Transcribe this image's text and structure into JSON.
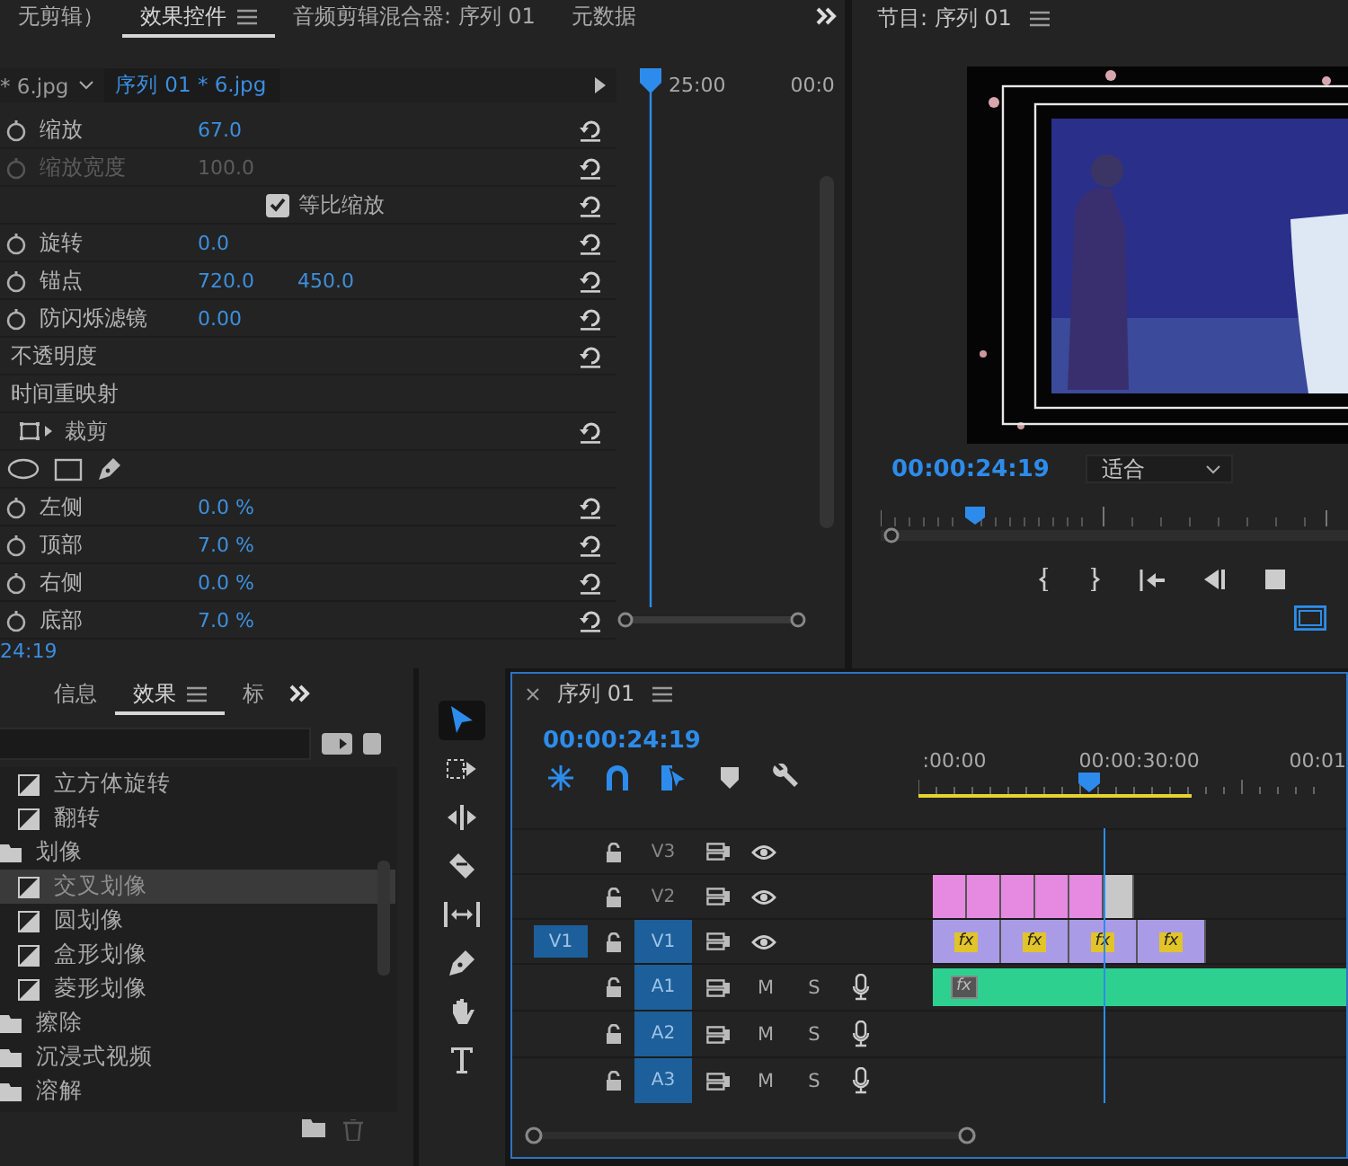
{
  "effect_controls": {
    "tabs": [
      {
        "label": "无剪辑）",
        "selected": false
      },
      {
        "label": "效果控件",
        "selected": true
      },
      {
        "label": "音频剪辑混合器: 序列 01",
        "selected": false
      },
      {
        "label": "元数据",
        "selected": false
      }
    ],
    "clip_source": "* 6.jpg",
    "clip_sequence": "序列 01 * 6.jpg",
    "ruler_labels": [
      "25:00",
      "00:0"
    ],
    "properties": [
      {
        "kind": "param",
        "name": "缩放",
        "values": [
          "67.0"
        ],
        "disabled": false,
        "reset": true
      },
      {
        "kind": "param",
        "name": "缩放宽度",
        "values": [
          "100.0"
        ],
        "disabled": true,
        "reset": true
      },
      {
        "kind": "checkbox",
        "name": "等比缩放",
        "checked": true,
        "reset": true
      },
      {
        "kind": "param",
        "name": "旋转",
        "values": [
          "0.0"
        ],
        "disabled": false,
        "reset": true
      },
      {
        "kind": "param",
        "name": "锚点",
        "values": [
          "720.0",
          "450.0"
        ],
        "disabled": false,
        "reset": true
      },
      {
        "kind": "param",
        "name": "防闪烁滤镜",
        "values": [
          "0.00"
        ],
        "disabled": false,
        "reset": true
      },
      {
        "kind": "section",
        "name": "不透明度",
        "reset": true
      },
      {
        "kind": "section",
        "name": "时间重映射",
        "reset": false
      },
      {
        "kind": "effect",
        "name": "裁剪",
        "reset": true
      },
      {
        "kind": "masks"
      },
      {
        "kind": "param",
        "name": "左侧",
        "values": [
          "0.0 %"
        ],
        "disabled": false,
        "reset": true
      },
      {
        "kind": "param",
        "name": "顶部",
        "values": [
          "7.0 %"
        ],
        "disabled": false,
        "reset": true
      },
      {
        "kind": "param",
        "name": "右侧",
        "values": [
          "0.0 %"
        ],
        "disabled": false,
        "reset": true
      },
      {
        "kind": "param",
        "name": "底部",
        "values": [
          "7.0 %"
        ],
        "disabled": false,
        "reset": true
      }
    ],
    "timecode": "24:19"
  },
  "program_monitor": {
    "title": "节目: 序列 01",
    "timecode": "00:00:24:19",
    "zoom": "适合"
  },
  "effects_panel": {
    "tabs": [
      {
        "label": "信息",
        "selected": false
      },
      {
        "label": "效果",
        "selected": true
      },
      {
        "label": "标",
        "selected": false
      }
    ],
    "items": [
      {
        "kind": "effect",
        "label": "立方体旋转",
        "selected": false
      },
      {
        "kind": "effect",
        "label": "翻转",
        "selected": false
      },
      {
        "kind": "folder",
        "label": "划像",
        "selected": false,
        "children": [
          {
            "kind": "effect",
            "label": "交叉划像",
            "selected": true
          },
          {
            "kind": "effect",
            "label": "圆划像",
            "selected": false
          },
          {
            "kind": "effect",
            "label": "盒形划像",
            "selected": false
          },
          {
            "kind": "effect",
            "label": "菱形划像",
            "selected": false
          }
        ]
      },
      {
        "kind": "folder",
        "label": "擦除",
        "selected": false
      },
      {
        "kind": "folder",
        "label": "沉浸式视频",
        "selected": false
      },
      {
        "kind": "folder",
        "label": "溶解",
        "selected": false
      }
    ]
  },
  "tools": [
    {
      "kind": "selection",
      "selected": true
    },
    {
      "kind": "track",
      "selected": false
    },
    {
      "kind": "ripple",
      "selected": false
    },
    {
      "kind": "razor",
      "selected": false
    },
    {
      "kind": "slip",
      "selected": false
    },
    {
      "kind": "pen",
      "selected": false
    },
    {
      "kind": "hand",
      "selected": false
    },
    {
      "kind": "type",
      "selected": false
    }
  ],
  "timeline": {
    "title": "序列 01",
    "timecode": "00:00:24:19",
    "toolbar": [
      {
        "kind": "nest",
        "on": true
      },
      {
        "kind": "snap",
        "on": true
      },
      {
        "kind": "linked",
        "on": true
      },
      {
        "kind": "marker",
        "on": false
      },
      {
        "kind": "settings",
        "on": false
      }
    ],
    "ruler_labels": [
      ":00:00",
      "00:00:30:00",
      "00:01"
    ],
    "tracks": [
      {
        "kind": "video",
        "name": "V3",
        "targeted": false
      },
      {
        "kind": "video",
        "name": "V2",
        "targeted": false,
        "clips": [
          {
            "color": "#e58ae0"
          },
          {
            "color": "#e58ae0"
          },
          {
            "color": "#e58ae0"
          },
          {
            "color": "#e58ae0"
          },
          {
            "color": "#e58ae0"
          },
          {
            "color": "#c8c8c8"
          }
        ]
      },
      {
        "kind": "video",
        "name": "V1",
        "source": "V1",
        "targeted": true,
        "clips": [
          {
            "color": "#a99be6",
            "fx_label": "fx"
          },
          {
            "color": "#a99be6",
            "fx_label": "fx"
          },
          {
            "color": "#a99be6",
            "fx_label": "fx"
          },
          {
            "color": "#a99be6",
            "fx_label": "fx"
          }
        ]
      },
      {
        "kind": "audio",
        "name": "A1",
        "targeted": true,
        "mute_label": "M",
        "solo_label": "S",
        "clips": [
          {
            "color": "#2ed08f",
            "fx_label": "fx"
          }
        ]
      },
      {
        "kind": "audio",
        "name": "A2",
        "targeted": true,
        "mute_label": "M",
        "solo_label": "S"
      },
      {
        "kind": "audio",
        "name": "A3",
        "targeted": true,
        "mute_label": "M",
        "solo_label": "S"
      }
    ]
  }
}
